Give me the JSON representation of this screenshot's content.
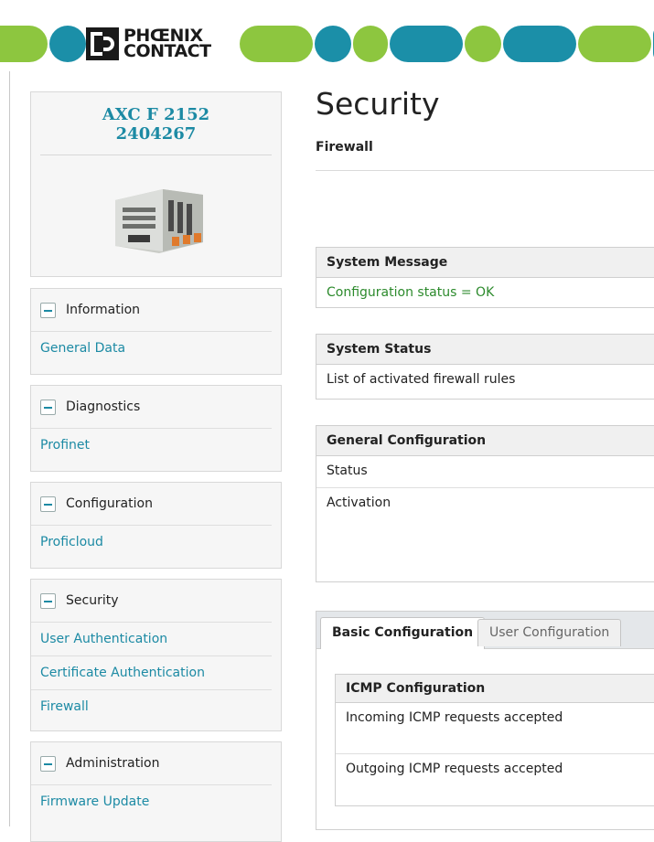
{
  "banner": {
    "logo_line1": "PHŒNIX",
    "logo_line2": "CONTACT",
    "colors": {
      "green": "#8dc63f",
      "teal": "#1b8fa8"
    }
  },
  "device": {
    "model": "AXC F 2152",
    "article": "2404267",
    "image_icon": "plc-controller-image"
  },
  "sidebar": {
    "sections": [
      {
        "title": "Information",
        "items": [
          "General Data"
        ]
      },
      {
        "title": "Diagnostics",
        "items": [
          "Profinet"
        ]
      },
      {
        "title": "Configuration",
        "items": [
          "Proficloud"
        ]
      },
      {
        "title": "Security",
        "items": [
          "User Authentication",
          "Certificate Authentication",
          "Firewall"
        ]
      },
      {
        "title": "Administration",
        "items": [
          "Firmware Update"
        ]
      }
    ]
  },
  "page": {
    "title": "Security",
    "subtitle": "Firewall"
  },
  "system_message": {
    "header": "System Message",
    "text": "Configuration status = OK"
  },
  "system_status": {
    "header": "System Status",
    "text": "List of activated firewall rules"
  },
  "general_config": {
    "header": "General Configuration",
    "status_label": "Status",
    "activation_label": "Activation"
  },
  "tabs": {
    "basic": "Basic Configuration",
    "user": "User Configuration"
  },
  "icmp": {
    "header": "ICMP Configuration",
    "incoming": "Incoming ICMP requests accepted",
    "outgoing": "Outgoing ICMP requests accepted"
  }
}
